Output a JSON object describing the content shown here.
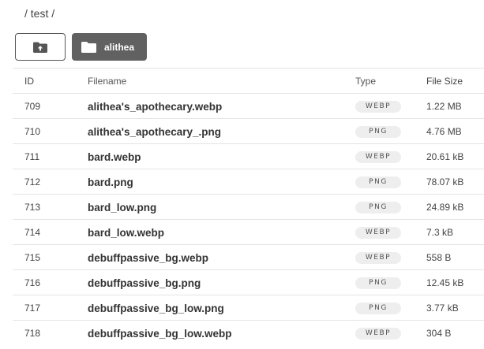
{
  "breadcrumb": "/ test /",
  "toolbar": {
    "up_icon": "folder-upload-icon",
    "folder_icon": "folder-icon",
    "folder_label": "alithea"
  },
  "table": {
    "headers": {
      "id": "ID",
      "filename": "Filename",
      "type": "Type",
      "size": "File Size"
    },
    "rows": [
      {
        "id": "709",
        "filename": "alithea's_apothecary.webp",
        "type": "WEBP",
        "size": "1.22 MB"
      },
      {
        "id": "710",
        "filename": "alithea's_apothecary_.png",
        "type": "PNG",
        "size": "4.76 MB"
      },
      {
        "id": "711",
        "filename": "bard.webp",
        "type": "WEBP",
        "size": "20.61 kB"
      },
      {
        "id": "712",
        "filename": "bard.png",
        "type": "PNG",
        "size": "78.07 kB"
      },
      {
        "id": "713",
        "filename": "bard_low.png",
        "type": "PNG",
        "size": "24.89 kB"
      },
      {
        "id": "714",
        "filename": "bard_low.webp",
        "type": "WEBP",
        "size": "7.3 kB"
      },
      {
        "id": "715",
        "filename": "debuffpassive_bg.webp",
        "type": "WEBP",
        "size": "558 B"
      },
      {
        "id": "716",
        "filename": "debuffpassive_bg.png",
        "type": "PNG",
        "size": "12.45 kB"
      },
      {
        "id": "717",
        "filename": "debuffpassive_bg_low.png",
        "type": "PNG",
        "size": "3.77 kB"
      },
      {
        "id": "718",
        "filename": "debuffpassive_bg_low.webp",
        "type": "WEBP",
        "size": "304 B"
      }
    ]
  }
}
